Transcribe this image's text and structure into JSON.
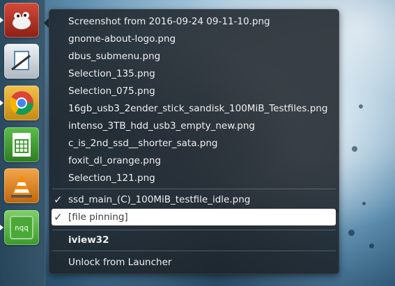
{
  "launcher": {
    "items": [
      {
        "name": "gimp",
        "icon": "gimp-icon",
        "color": "#c0392b"
      },
      {
        "name": "preview",
        "icon": "image-viewer-icon",
        "color": "#d6dde3"
      },
      {
        "name": "chrome",
        "icon": "chrome-icon",
        "color": "#e8a21b"
      },
      {
        "name": "libreoffice-calc",
        "icon": "spreadsheet-icon",
        "color": "#3a9a2a"
      },
      {
        "name": "vlc",
        "icon": "vlc-icon",
        "color": "#e8841a"
      },
      {
        "name": "iview32",
        "icon": "wine-app-icon",
        "color": "#4caf3a",
        "label": "nqq"
      }
    ]
  },
  "menu": {
    "recent_files": [
      "Screenshot from 2016-09-24 09-11-10.png",
      "gnome-about-logo.png",
      "dbus_submenu.png",
      "Selection_135.png",
      "Selection_075.png",
      "16gb_usb3_2ender_stick_sandisk_100MiB_Testfiles.png",
      "intenso_3TB_hdd_usb3_empty_new.png",
      "c_is_2nd_ssd__shorter_sata.png",
      "foxit_dl_orange.png",
      "Selection_121.png"
    ],
    "checked_file": "ssd_main_(C)_100MiB_testfile_idle.png",
    "file_pinning": "[file pinning]",
    "check_mark": "✓",
    "app_name": "iview32",
    "unlock": "Unlock from Launcher"
  }
}
